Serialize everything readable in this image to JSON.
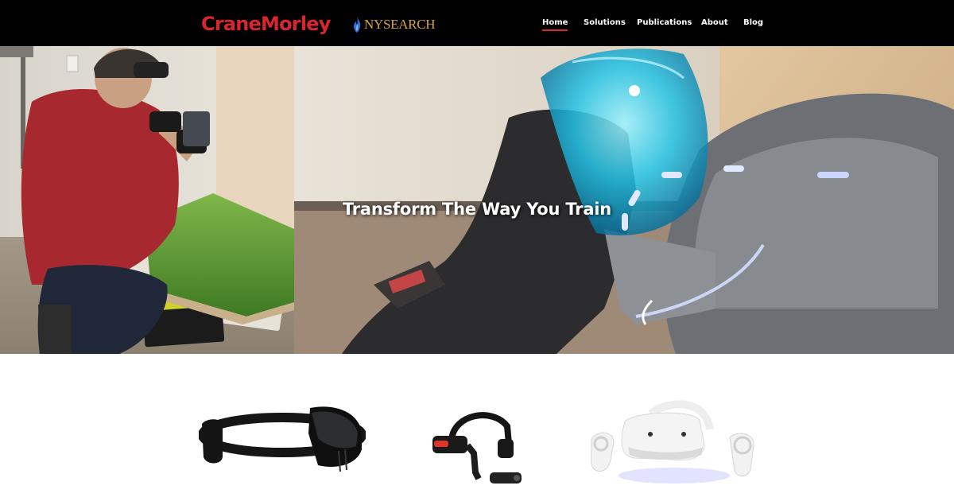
{
  "brand": {
    "logo_text": "CraneMorley",
    "partner_text": "NYSEARCH",
    "accent_color": "#d9262c",
    "partner_color": "#d9a33a",
    "partner_icon": "flame-icon"
  },
  "nav": {
    "items": [
      {
        "label": "Home",
        "active": true
      },
      {
        "label": "Solutions",
        "active": false
      },
      {
        "label": "Publications",
        "active": false
      },
      {
        "label": "About",
        "active": false
      },
      {
        "label": "Blog",
        "active": false
      }
    ]
  },
  "hero": {
    "title": "Transform The Way You Train"
  },
  "devices": [
    {
      "name": "mixed-reality-headset"
    },
    {
      "name": "smart-glasses-headset"
    },
    {
      "name": "vr-headset-with-controllers"
    }
  ]
}
